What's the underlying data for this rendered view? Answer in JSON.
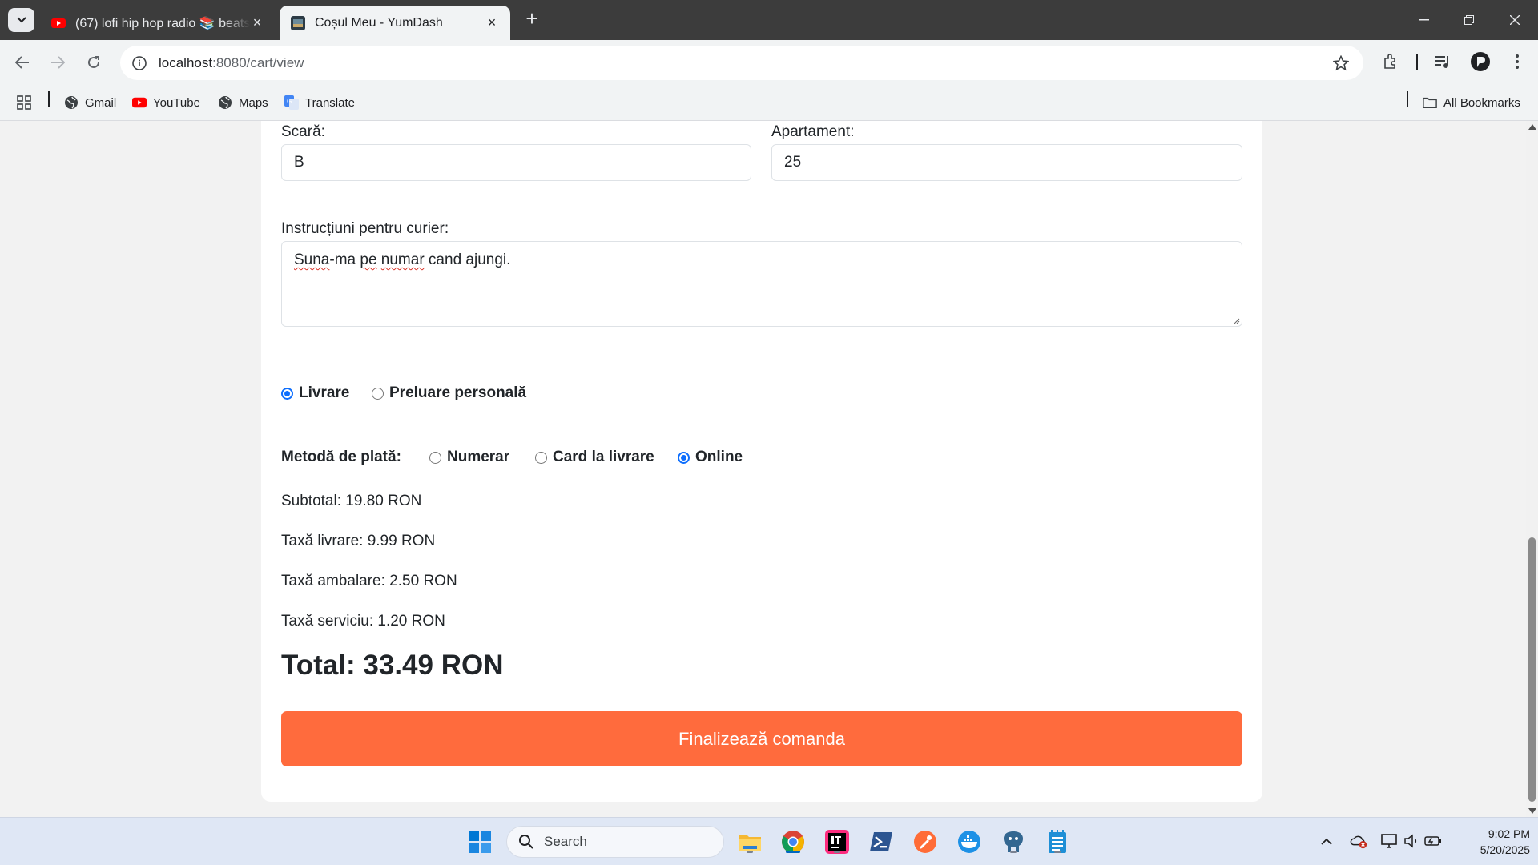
{
  "browser": {
    "tabs": [
      {
        "title": "(67) lofi hip hop radio 📚 beats to relax/study to",
        "active": false
      },
      {
        "title": "Coșul Meu - YumDash",
        "active": true
      }
    ],
    "url_host": "localhost",
    "url_path": ":8080/cart/view",
    "bookmarks": [
      "Gmail",
      "YouTube",
      "Maps",
      "Translate"
    ],
    "all_bookmarks": "All Bookmarks"
  },
  "form": {
    "scara_label": "Scară:",
    "scara_value": "B",
    "apartament_label": "Apartament:",
    "apartament_value": "25",
    "instructions_label": "Instrucțiuni pentru curier:",
    "instructions_words": [
      "Suna",
      "-ma ",
      "pe",
      " ",
      "numar",
      " cand ajungi."
    ]
  },
  "delivery": {
    "options": [
      {
        "label": "Livrare",
        "checked": true
      },
      {
        "label": "Preluare personală",
        "checked": false
      }
    ]
  },
  "payment": {
    "label": "Metodă de plată:",
    "options": [
      {
        "label": "Numerar",
        "checked": false
      },
      {
        "label": "Card la livrare",
        "checked": false
      },
      {
        "label": "Online",
        "checked": true
      }
    ]
  },
  "summary": {
    "subtotal": "Subtotal: 19.80 RON",
    "delivery_fee": "Taxă livrare: 9.99 RON",
    "packaging_fee": "Taxă ambalare: 2.50 RON",
    "service_fee": "Taxă serviciu: 1.20 RON",
    "total": "Total: 33.49 RON"
  },
  "submit_label": "Finalizează comanda",
  "taskbar": {
    "search_placeholder": "Search",
    "time": "9:02 PM",
    "date": "5/20/2025"
  },
  "colors": {
    "accent_button": "#ff6b3d",
    "radio_checked": "#0d6efd"
  }
}
